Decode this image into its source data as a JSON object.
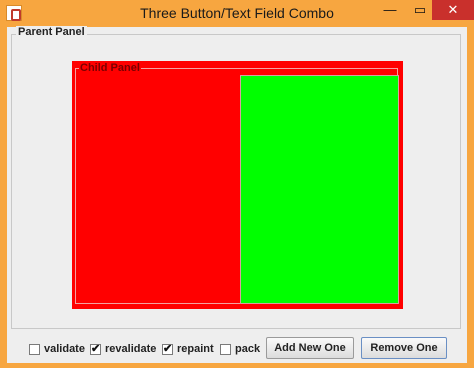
{
  "window": {
    "title": "Three Button/Text Field Combo",
    "minimize_glyph": "—",
    "maximize_glyph": "▭",
    "close_glyph": "✕",
    "icon": "java-app-icon"
  },
  "parent_panel": {
    "label": "Parent Panel"
  },
  "child_panel": {
    "label": "Child Panel",
    "background": "#ff0000"
  },
  "inner_panel": {
    "background": "#00ff00"
  },
  "controls": {
    "checkboxes": [
      {
        "label": "validate",
        "checked": false
      },
      {
        "label": "revalidate",
        "checked": true
      },
      {
        "label": "repaint",
        "checked": true
      },
      {
        "label": "pack",
        "checked": false
      }
    ],
    "add_button": "Add New One",
    "remove_button": "Remove One"
  }
}
